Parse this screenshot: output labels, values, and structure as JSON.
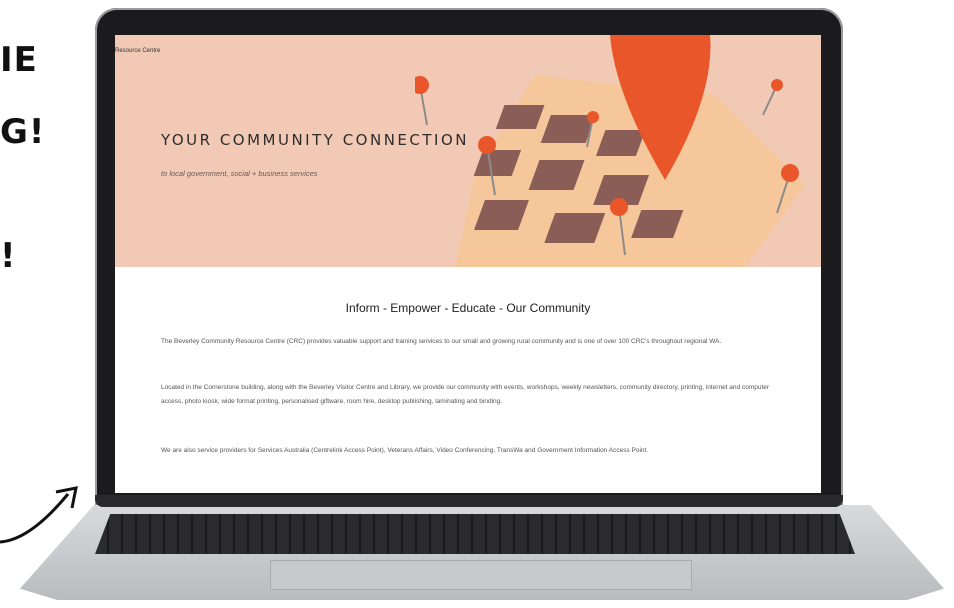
{
  "background": {
    "lines": [
      "IE",
      "G!",
      "!"
    ]
  },
  "site": {
    "name": "Resource Centre"
  },
  "hero": {
    "title": "YOUR COMMUNITY CONNECTION",
    "subtitle": "to local government, social + business services"
  },
  "content": {
    "heading": "Inform - Empower - Educate - Our Community",
    "paragraphs": [
      "The Beverley Community Resource Centre (CRC) provides valuable support and training services to our small and growing rural community and is one of over 100 CRC's throughout regional WA.",
      "Located in the Cornerstone building, along with the Beverley Visitor Centre and Library, we provide our community with events, workshops, weekly newsletters, community directory, printing, internet and computer access, photo kiosk, wide format printing, personalised giftware, room hire, desktop publishing, laminating and binding.",
      "We are also service providers for Services Australia (Centrelink Access Point), Veterans Affairs, Video Conferencing, TransWa and Government Information Access Point."
    ]
  },
  "colors": {
    "hero_bg": "#f1c9b5",
    "pin": "#e8562a",
    "map_tan": "#f6c79a",
    "map_brown": "#8a5e57"
  },
  "icons": [
    "map-pin-icon",
    "map-illustration",
    "arrow-icon"
  ]
}
